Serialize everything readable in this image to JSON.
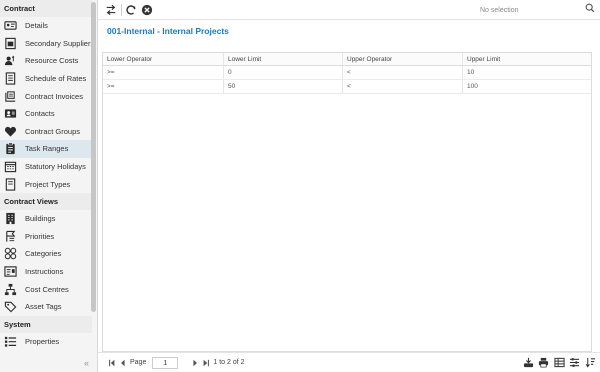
{
  "sidebar": {
    "sections": [
      {
        "title": "Contract",
        "items": [
          {
            "label": "Details",
            "icon": "id-card-icon"
          },
          {
            "label": "Secondary Suppliers",
            "icon": "supplier-icon"
          },
          {
            "label": "Resource Costs",
            "icon": "resource-costs-icon"
          },
          {
            "label": "Schedule of Rates",
            "icon": "document-list-icon"
          },
          {
            "label": "Contract Invoices",
            "icon": "invoice-icon"
          },
          {
            "label": "Contacts",
            "icon": "contact-card-icon"
          },
          {
            "label": "Contract Groups",
            "icon": "group-icon"
          },
          {
            "label": "Task Ranges",
            "icon": "clipboard-icon",
            "active": true
          },
          {
            "label": "Statutory Holidays",
            "icon": "calendar-icon"
          },
          {
            "label": "Project Types",
            "icon": "document-icon"
          }
        ]
      },
      {
        "title": "Contract Views",
        "items": [
          {
            "label": "Buildings",
            "icon": "building-icon"
          },
          {
            "label": "Priorities",
            "icon": "priority-icon"
          },
          {
            "label": "Categories",
            "icon": "categories-icon"
          },
          {
            "label": "Instructions",
            "icon": "instructions-icon"
          },
          {
            "label": "Cost Centres",
            "icon": "hierarchy-icon"
          },
          {
            "label": "Asset Tags",
            "icon": "tag-icon"
          }
        ]
      },
      {
        "title": "System",
        "items": [
          {
            "label": "Properties",
            "icon": "list-icon"
          }
        ]
      }
    ]
  },
  "toolbar": {
    "selection_text": "No selection"
  },
  "page": {
    "title": "001-Internal - Internal Projects"
  },
  "grid": {
    "columns": [
      "Lower Operator",
      "Lower Limit",
      "Upper Operator",
      "Upper Limit"
    ],
    "rows": [
      [
        ">=",
        "0",
        "<",
        "10"
      ],
      [
        ">=",
        "50",
        "<",
        "100"
      ]
    ]
  },
  "pager": {
    "page_label": "Page",
    "current_page": "1",
    "range_text": "1 to 2 of 2"
  },
  "colors": {
    "accent": "#1a7bbf",
    "active_bg": "#dde8ee",
    "icon": "#2b2b2b"
  }
}
